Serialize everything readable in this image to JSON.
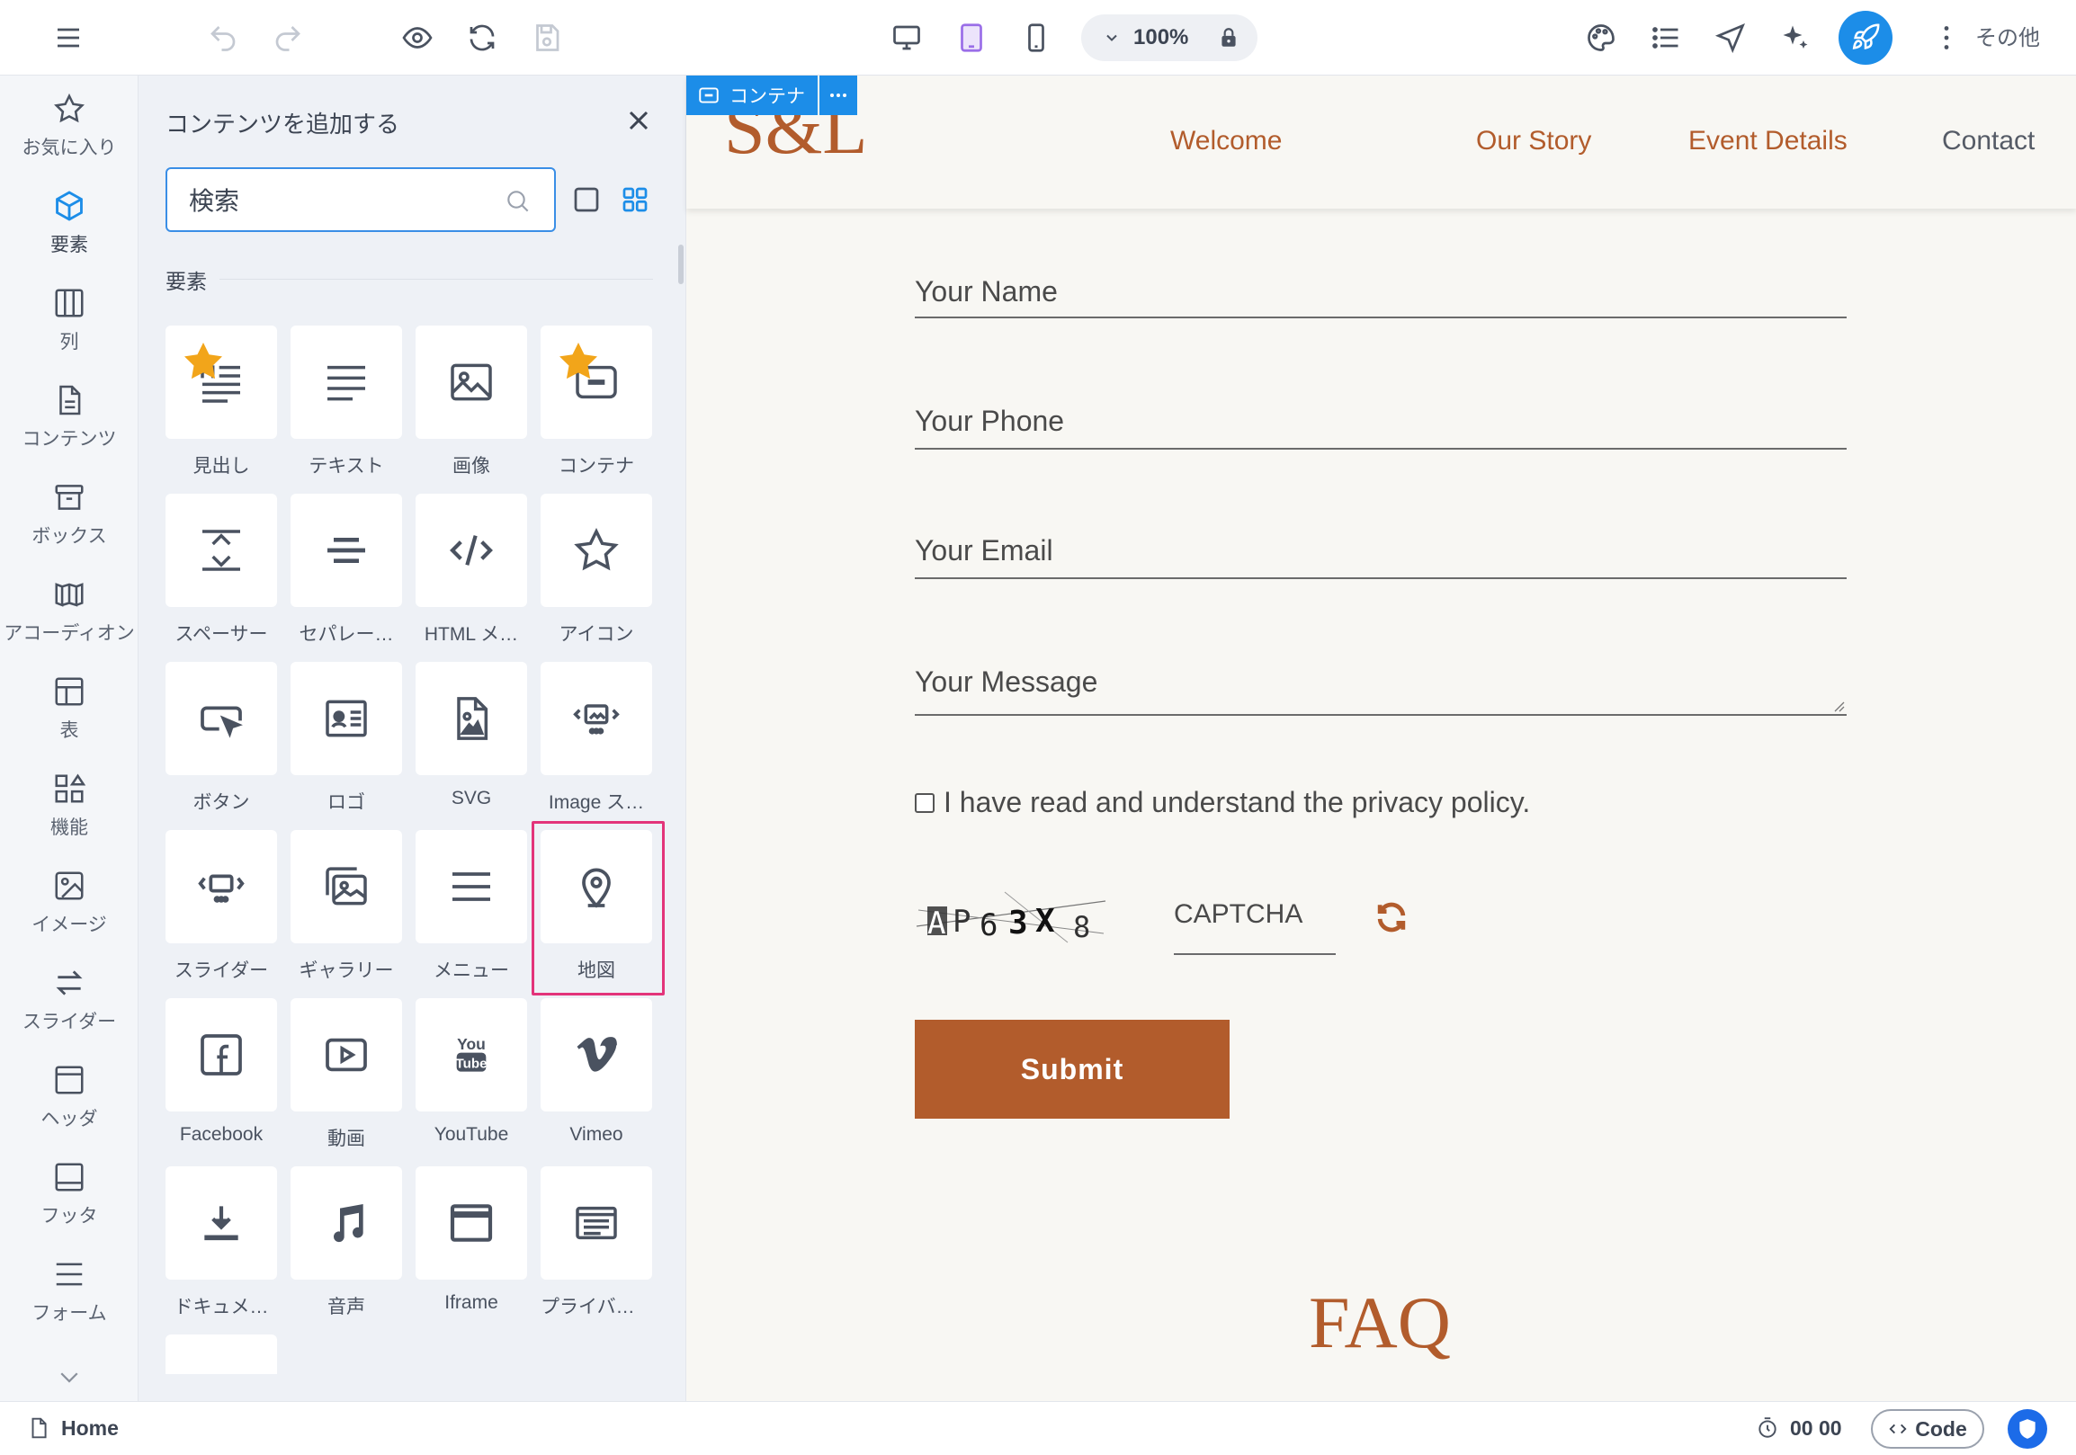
{
  "toolbar": {
    "zoom": "100%",
    "more_label": "その他"
  },
  "rail": {
    "items": [
      {
        "label": "お気に入り",
        "icon": "star-icon"
      },
      {
        "label": "要素",
        "icon": "cube-icon"
      },
      {
        "label": "列",
        "icon": "columns-icon"
      },
      {
        "label": "コンテンツ",
        "icon": "document-icon"
      },
      {
        "label": "ボックス",
        "icon": "box-icon"
      },
      {
        "label": "アコーディオン",
        "icon": "accordion-icon"
      },
      {
        "label": "表",
        "icon": "table-icon"
      },
      {
        "label": "機能",
        "icon": "features-icon"
      },
      {
        "label": "イメージ",
        "icon": "image-icon"
      },
      {
        "label": "スライダー",
        "icon": "slider-arrows-icon"
      },
      {
        "label": "ヘッダ",
        "icon": "header-icon"
      },
      {
        "label": "フッタ",
        "icon": "footer-icon"
      },
      {
        "label": "フォーム",
        "icon": "form-icon"
      }
    ],
    "active_index": 1
  },
  "panel": {
    "title": "コンテンツを追加する",
    "search_value": "検索",
    "section_label": "要素",
    "tiles": [
      {
        "label": "見出し",
        "icon": "heading-icon",
        "favorite": true
      },
      {
        "label": "テキスト",
        "icon": "text-icon",
        "favorite": false
      },
      {
        "label": "画像",
        "icon": "image-icon",
        "favorite": false
      },
      {
        "label": "コンテナ",
        "icon": "container-icon",
        "favorite": true
      },
      {
        "label": "スペーサー",
        "icon": "spacer-icon",
        "favorite": false
      },
      {
        "label": "セパレー…",
        "icon": "separator-icon",
        "favorite": false
      },
      {
        "label": "HTML メ…",
        "icon": "code-icon",
        "favorite": false
      },
      {
        "label": "アイコン",
        "icon": "star-outline-icon",
        "favorite": false
      },
      {
        "label": "ボタン",
        "icon": "button-icon",
        "favorite": false
      },
      {
        "label": "ロゴ",
        "icon": "logo-card-icon",
        "favorite": false
      },
      {
        "label": "SVG",
        "icon": "svg-file-icon",
        "favorite": false
      },
      {
        "label": "Image ス…",
        "icon": "image-slider-icon",
        "favorite": false
      },
      {
        "label": "スライダー",
        "icon": "slider-icon",
        "favorite": false
      },
      {
        "label": "ギャラリー",
        "icon": "gallery-icon",
        "favorite": false
      },
      {
        "label": "メニュー",
        "icon": "menu-icon",
        "favorite": false
      },
      {
        "label": "地図",
        "icon": "map-pin-icon",
        "favorite": false,
        "highlighted": true
      },
      {
        "label": "Facebook",
        "icon": "facebook-icon",
        "favorite": false
      },
      {
        "label": "動画",
        "icon": "video-icon",
        "favorite": false
      },
      {
        "label": "YouTube",
        "icon": "youtube-icon",
        "favorite": false
      },
      {
        "label": "Vimeo",
        "icon": "vimeo-icon",
        "favorite": false
      },
      {
        "label": "ドキュメ…",
        "icon": "download-icon",
        "favorite": false
      },
      {
        "label": "音声",
        "icon": "music-icon",
        "favorite": false
      },
      {
        "label": "Iframe",
        "icon": "iframe-icon",
        "favorite": false
      },
      {
        "label": "プライバシ…",
        "icon": "privacy-icon",
        "favorite": false
      }
    ]
  },
  "canvas": {
    "container_tag": "コンテナ",
    "logo": "S&L",
    "nav": [
      "Welcome",
      "Our Story",
      "Event Details",
      "Contact"
    ],
    "form": {
      "name_placeholder": "Your Name",
      "phone_placeholder": "Your Phone",
      "email_placeholder": "Your Email",
      "message_placeholder": "Your Message",
      "consent_text": "I have read and understand the privacy policy.",
      "captcha_placeholder": "CAPTCHA",
      "submit_label": "Submit"
    },
    "faq_title": "FAQ",
    "accent_color": "#b25c2c"
  },
  "status": {
    "page": "Home",
    "timer": "00 00",
    "code_label": "Code"
  }
}
